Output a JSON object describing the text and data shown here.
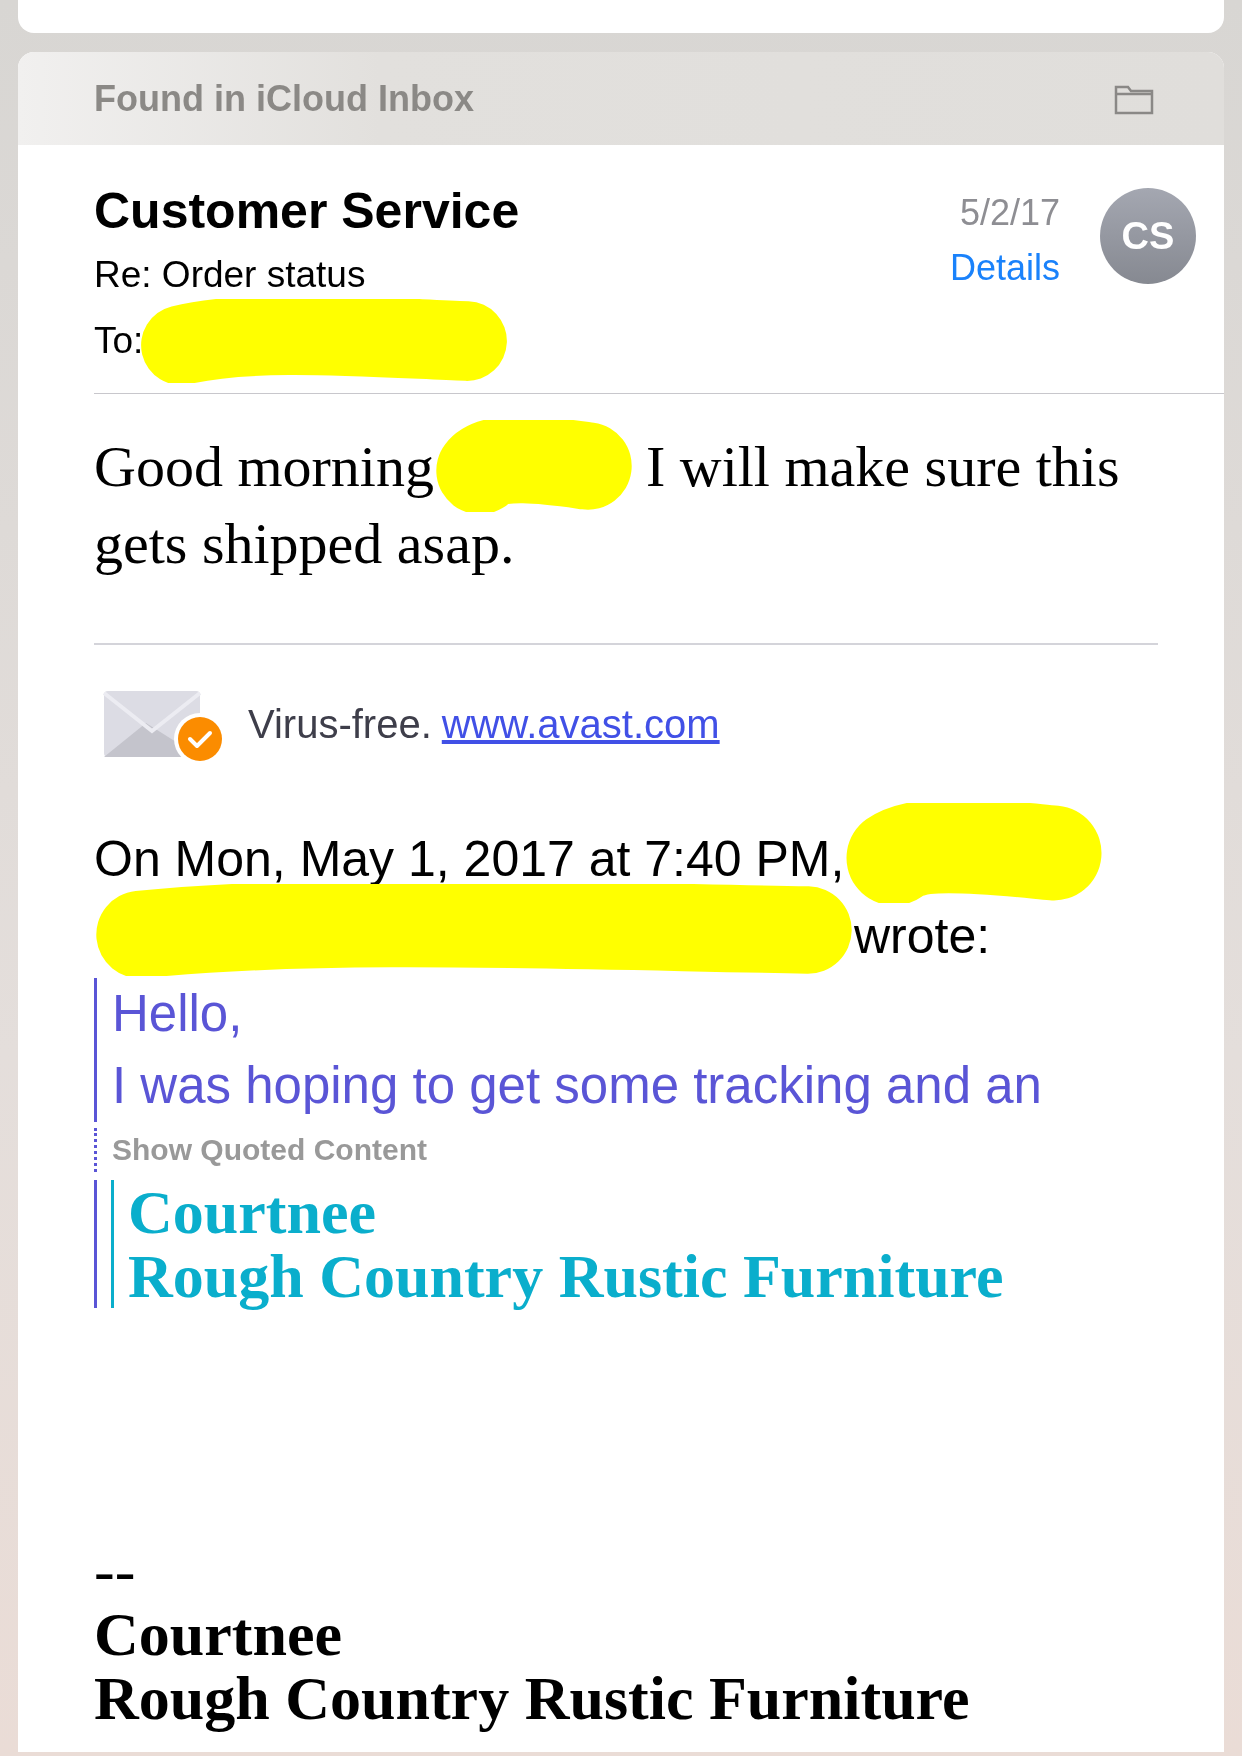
{
  "header": {
    "title": "Found in iCloud Inbox"
  },
  "message": {
    "sender": "Customer Service",
    "subject": "Re: Order status",
    "to_label": "To:",
    "date": "5/2/17",
    "details_link": "Details",
    "avatar_initials": "CS"
  },
  "body": {
    "greeting": "Good morning",
    "lines": [
      "I will make sure this",
      "gets shipped asap."
    ]
  },
  "virus_banner": {
    "text": "Virus-free.",
    "link": "www.avast.com"
  },
  "reply": {
    "attribution": "On Mon, May 1, 2017 at 7:40 PM,",
    "attribution_end": "wrote:",
    "quoted_lines": [
      "Hello,",
      "I was hoping to get some tracking and an"
    ],
    "show_quoted": "Show Quoted Content",
    "nested_quote_lines": [
      "Courtnee",
      "Rough Country Rustic Furniture"
    ]
  },
  "signature": {
    "separator": "--",
    "lines": [
      "Courtnee",
      "Rough Country Rustic Furniture"
    ]
  }
}
